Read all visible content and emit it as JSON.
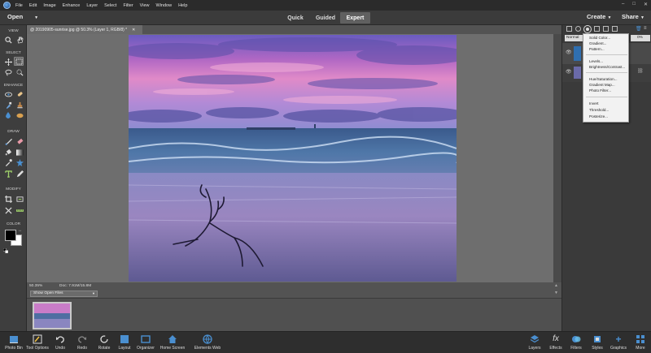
{
  "menubar": {
    "items": [
      "File",
      "Edit",
      "Image",
      "Enhance",
      "Layer",
      "Select",
      "Filter",
      "View",
      "Window",
      "Help"
    ]
  },
  "modebar": {
    "open_label": "Open",
    "modes": [
      "Quick",
      "Guided",
      "Expert"
    ],
    "active_mode": "Expert",
    "create_label": "Create",
    "share_label": "Share"
  },
  "document": {
    "tab_title": "@ 20190905-sunrise.jpg @ 50.3% (Layer 1, RGB/8) *",
    "zoom": "50.35%",
    "doc_size": "Doc: 7.91M/15.8M"
  },
  "toolbox": {
    "sections": [
      "VIEW",
      "SELECT",
      "ENHANCE",
      "DRAW",
      "MODIFY",
      "COLOR"
    ],
    "colors": {
      "foreground": "#000000",
      "background": "#ffffff"
    }
  },
  "photobin": {
    "dropdown_label": "Show Open Files"
  },
  "panel": {
    "blend_mode": "Normal",
    "opacity": "0%"
  },
  "adjustment_menu": {
    "groups": [
      [
        "Solid Color...",
        "Gradient...",
        "Pattern..."
      ],
      [
        "Levels...",
        "Brightness/Contrast..."
      ],
      [
        "Hue/Saturation...",
        "Gradient Map...",
        "Photo Filter..."
      ],
      [
        "Invert",
        "Threshold...",
        "Posterize..."
      ]
    ]
  },
  "taskbar": {
    "left": [
      "Photo Bin",
      "Tool Options",
      "Undo",
      "Redo",
      "Rotate",
      "Layout",
      "Organizer",
      "Home Screen",
      "Elements Web"
    ],
    "right": [
      "Layers",
      "Effects",
      "Filters",
      "Styles",
      "Graphics",
      "More"
    ]
  },
  "theme": {
    "accent": "#2f6fb0",
    "active_mode_bg": "#606060"
  }
}
